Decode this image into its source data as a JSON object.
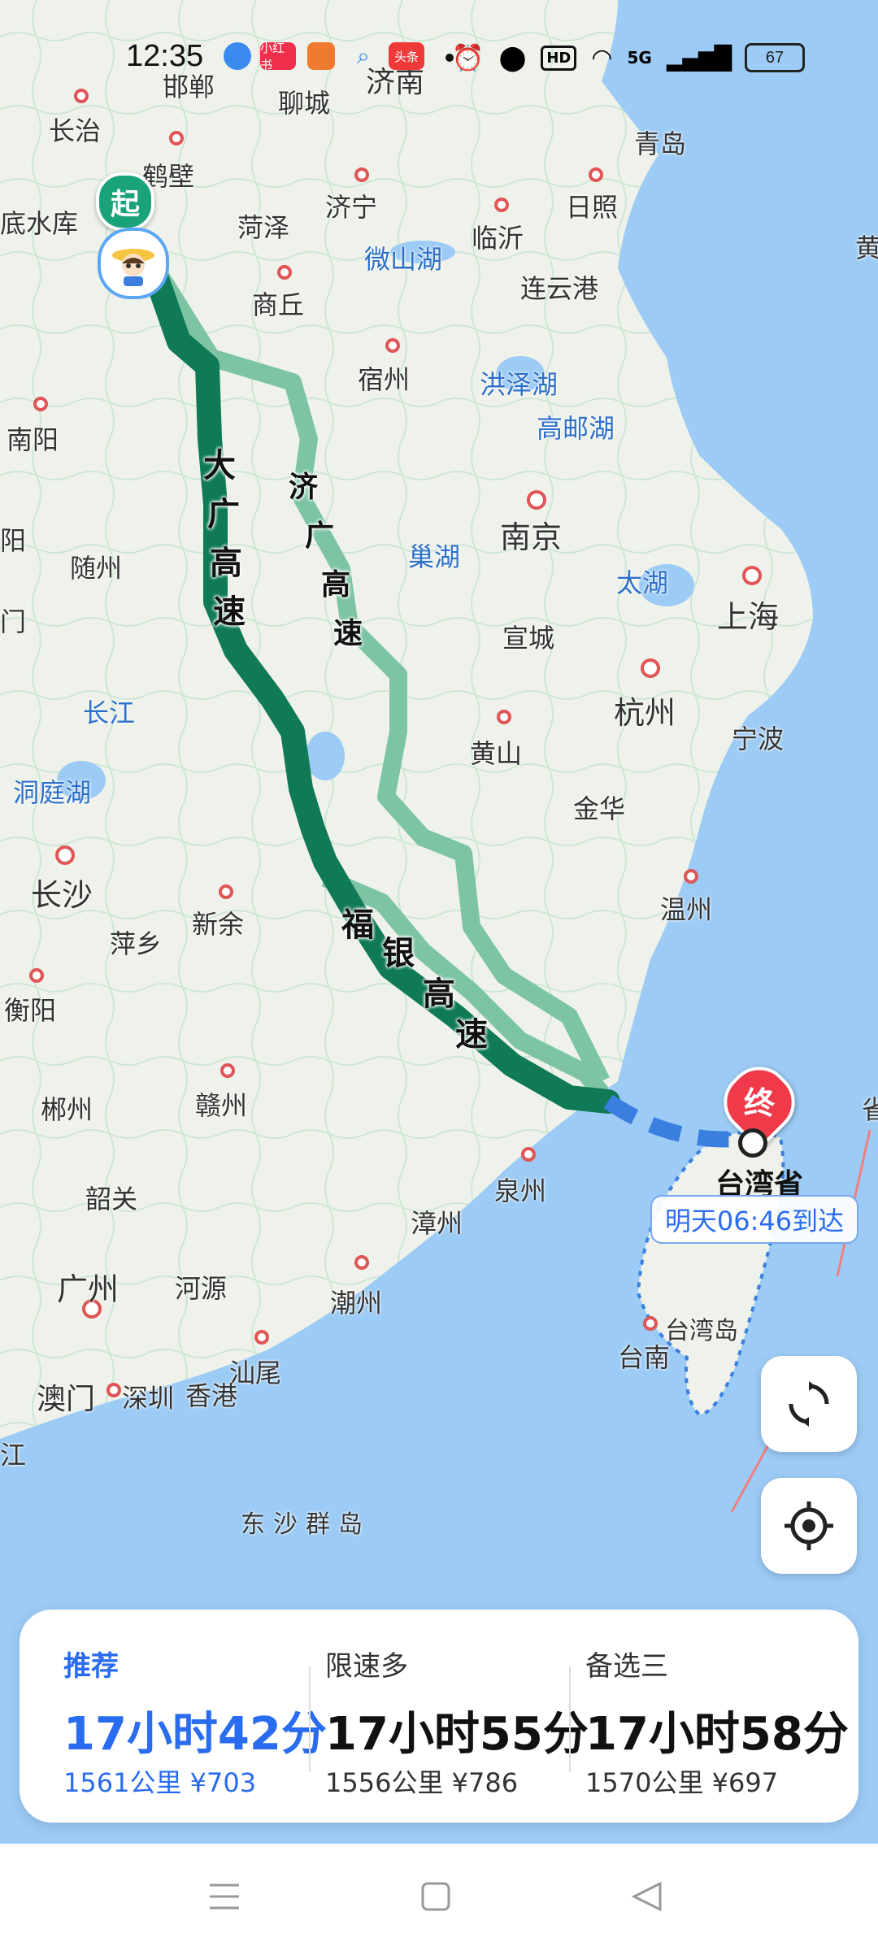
{
  "status_bar": {
    "time": "12:35",
    "app_icons": [
      "blue-app-icon",
      "xiaohongshu-icon",
      "video-app-icon",
      "search-app-icon",
      "toutiao-icon"
    ],
    "app_badges": {
      "xiaohongshu": "小红书",
      "toutiao": "头条"
    },
    "right_icons": [
      "alarm-icon",
      "location-icon",
      "hd-icon",
      "wifi-icon",
      "signal-icon"
    ],
    "network": "5G",
    "hd": "HD",
    "battery": "67"
  },
  "map": {
    "colors": {
      "land": "#eef2ea",
      "sea": "#9ccbf5",
      "road": "#b7e3c3",
      "route_main": "#0f7a55",
      "route_alt": "#7cc4a4"
    },
    "cities": [
      "济南",
      "邯郸",
      "聊城",
      "长治",
      "鹤壁",
      "青岛",
      "菏泽",
      "济宁",
      "日照",
      "临沂",
      "微山湖",
      "连云港",
      "底水库",
      "商丘",
      "宿州",
      "洪泽湖",
      "高邮湖",
      "南阳",
      "南京",
      "巢湖",
      "太湖",
      "上海",
      "随州",
      "宣城",
      "杭州",
      "长江",
      "黄山",
      "宁波",
      "洞庭湖",
      "金华",
      "长沙",
      "新余",
      "温州",
      "萍乡",
      "衡阳",
      "郴州",
      "赣州",
      "泉州",
      "韶关",
      "漳州",
      "广州",
      "河源",
      "潮州",
      "台南",
      "汕尾",
      "澳门",
      "深圳",
      "香港",
      "东沙群岛",
      "台湾岛",
      "阳",
      "门",
      "江",
      "黄",
      "省"
    ],
    "roads": [
      "大广高速",
      "济广高速",
      "福银高速"
    ],
    "start_marker": "起",
    "end_marker": "终",
    "destination": "台湾省",
    "eta": "明天06:46到达"
  },
  "controls": {
    "refresh": "refresh-icon",
    "locate": "locate-icon"
  },
  "routes": [
    {
      "label": "推荐",
      "duration": "17小时42分",
      "distance": "1561公里",
      "cost": "¥703",
      "active": true
    },
    {
      "label": "限速多",
      "duration": "17小时55分",
      "distance": "1556公里",
      "cost": "¥786",
      "active": false
    },
    {
      "label": "备选三",
      "duration": "17小时58分",
      "distance": "1570公里",
      "cost": "¥697",
      "active": false
    }
  ],
  "nav_bar": [
    "menu-icon",
    "home-icon",
    "back-icon"
  ]
}
